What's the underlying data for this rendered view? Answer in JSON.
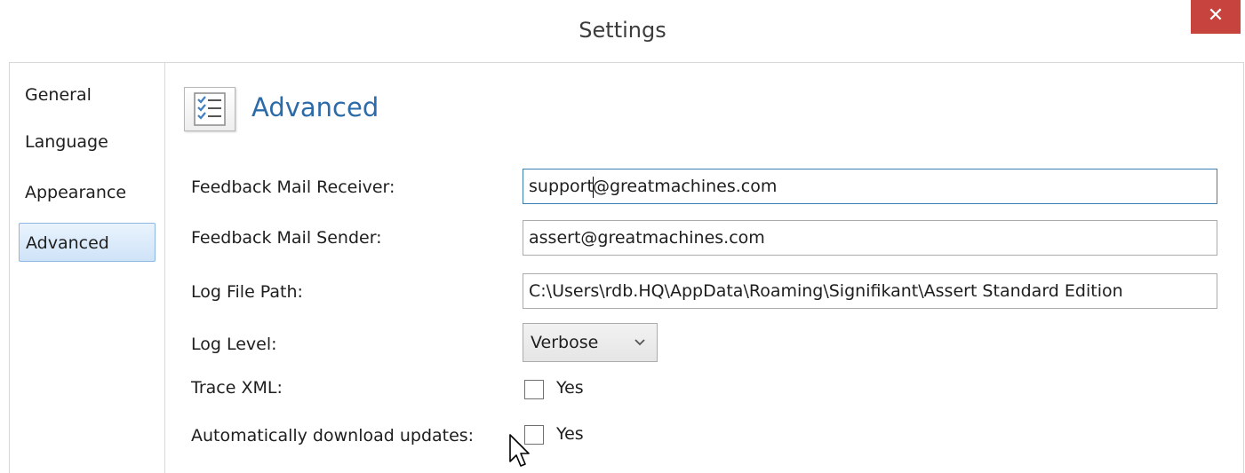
{
  "window": {
    "title": "Settings",
    "close_glyph": "✕"
  },
  "sidebar": {
    "items": [
      {
        "label": "General",
        "active": false
      },
      {
        "label": "Language",
        "active": false
      },
      {
        "label": "Appearance",
        "active": false
      },
      {
        "label": "Advanced",
        "active": true
      }
    ]
  },
  "section": {
    "icon": "checklist-icon",
    "title": "Advanced"
  },
  "fields": {
    "feedback_receiver": {
      "label": "Feedback Mail Receiver:",
      "value_before_caret": "support",
      "value_after_caret": "@greatmachines.com"
    },
    "feedback_sender": {
      "label": "Feedback Mail Sender:",
      "value": "assert@greatmachines.com"
    },
    "log_file_path": {
      "label": "Log File Path:",
      "value": "C:\\Users\\rdb.HQ\\AppData\\Roaming\\Signifikant\\Assert Standard Edition"
    },
    "log_level": {
      "label": "Log Level:",
      "value": "Verbose"
    },
    "trace_xml": {
      "label": "Trace XML:",
      "option": "Yes",
      "checked": false
    },
    "auto_update": {
      "label": "Automatically download updates:",
      "option": "Yes",
      "checked": false
    }
  },
  "colors": {
    "close_button": "#c7443e",
    "section_title": "#2c6aa8",
    "active_nav_border": "#8fb7e3"
  }
}
